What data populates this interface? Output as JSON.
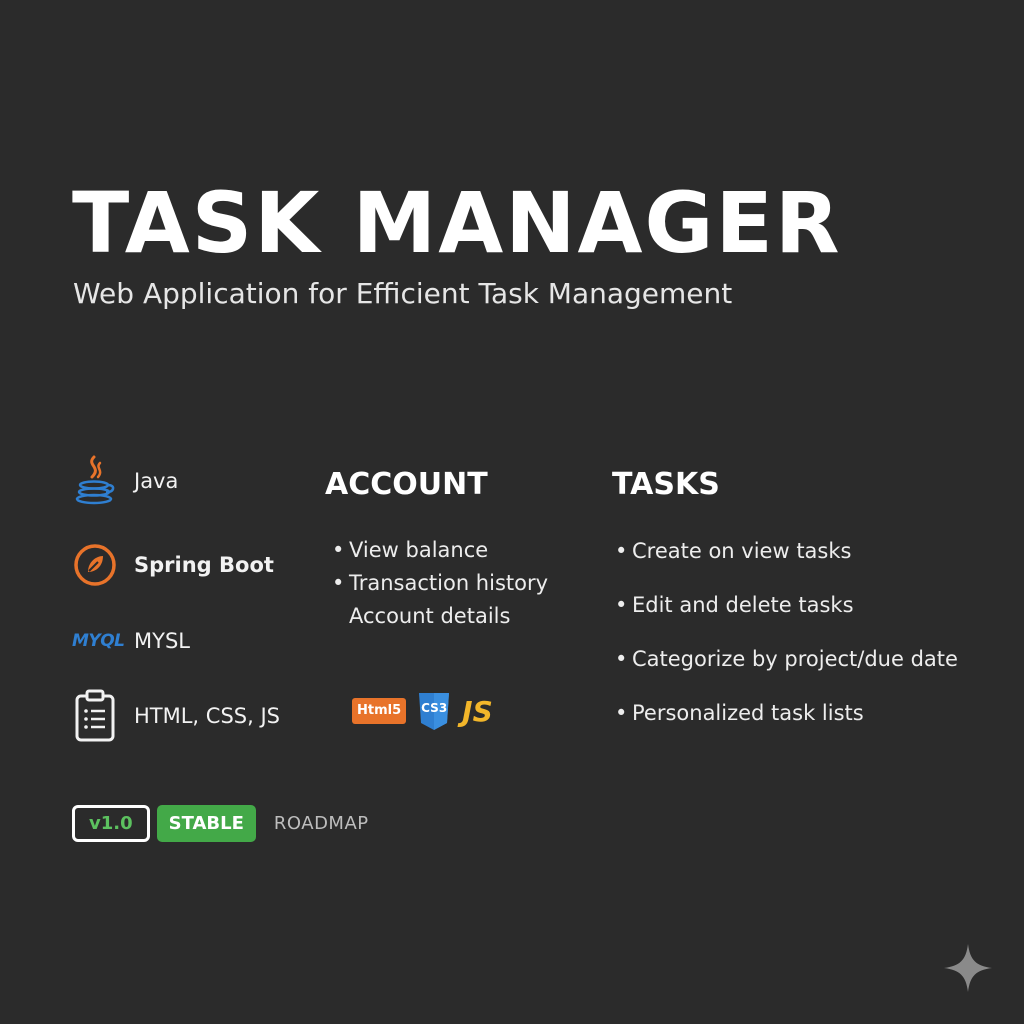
{
  "header": {
    "title": "TASK MANAGER",
    "subtitle": "Web Application for Efficient Task Management"
  },
  "tech_stack": [
    {
      "icon": "java-icon",
      "label": "Java"
    },
    {
      "icon": "spring-boot-icon",
      "label": "Spring Boot"
    },
    {
      "icon": "mysql-logo",
      "logo_text": "MYQL",
      "label": "MYSL"
    },
    {
      "icon": "clipboard-icon",
      "label": "HTML, CSS, JS"
    }
  ],
  "account": {
    "heading": "ACCOUNT",
    "items": [
      "View balance",
      "Transaction history",
      "Account details"
    ]
  },
  "web_badges": {
    "html": "Html5",
    "css": "CS3",
    "js": "JS"
  },
  "tasks": {
    "heading": "TASKS",
    "items": [
      "Create on view tasks",
      "Edit and delete tasks",
      "Categorize by project/due date",
      "Personalized task lists"
    ]
  },
  "tags": {
    "version": "v1.0",
    "status": "STABLE",
    "roadmap": "ROADMAP"
  },
  "colors": {
    "background": "#2b2b2b",
    "stable_green": "#43a948",
    "version_text_green": "#5cc15f",
    "html_orange": "#e8732a",
    "css_blue": "#2f7fd1",
    "js_yellow": "#f2b62a",
    "spring_orange": "#e8732a"
  }
}
